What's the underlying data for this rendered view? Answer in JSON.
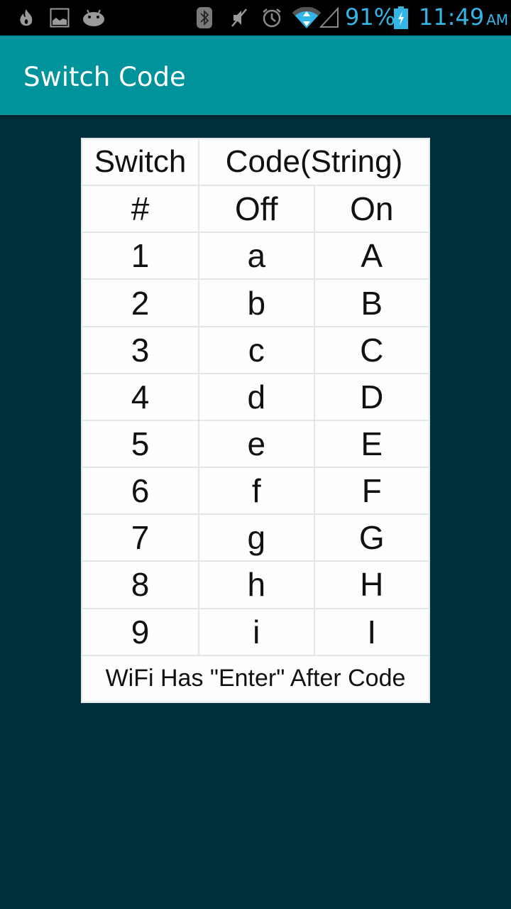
{
  "status_bar": {
    "left_icons": [
      "flame-icon",
      "image-icon",
      "android-icon"
    ],
    "right_icons": [
      "bluetooth-icon",
      "mute-icon",
      "alarm-icon",
      "wifi-icon",
      "signal-icon",
      "battery-charging-icon"
    ],
    "battery": "91%",
    "time": "11:49",
    "ampm": "AM"
  },
  "app_bar": {
    "title": "Switch Code"
  },
  "table": {
    "header_row1": [
      "Switch",
      "Code(String)"
    ],
    "header_row2": [
      "#",
      "Off",
      "On"
    ],
    "rows": [
      [
        "1",
        "a",
        "A"
      ],
      [
        "2",
        "b",
        "B"
      ],
      [
        "3",
        "c",
        "C"
      ],
      [
        "4",
        "d",
        "D"
      ],
      [
        "5",
        "e",
        "E"
      ],
      [
        "6",
        "f",
        "F"
      ],
      [
        "7",
        "g",
        "G"
      ],
      [
        "8",
        "h",
        "H"
      ],
      [
        "9",
        "i",
        "I"
      ]
    ],
    "footer": "WiFi Has \"Enter\" After Code"
  }
}
